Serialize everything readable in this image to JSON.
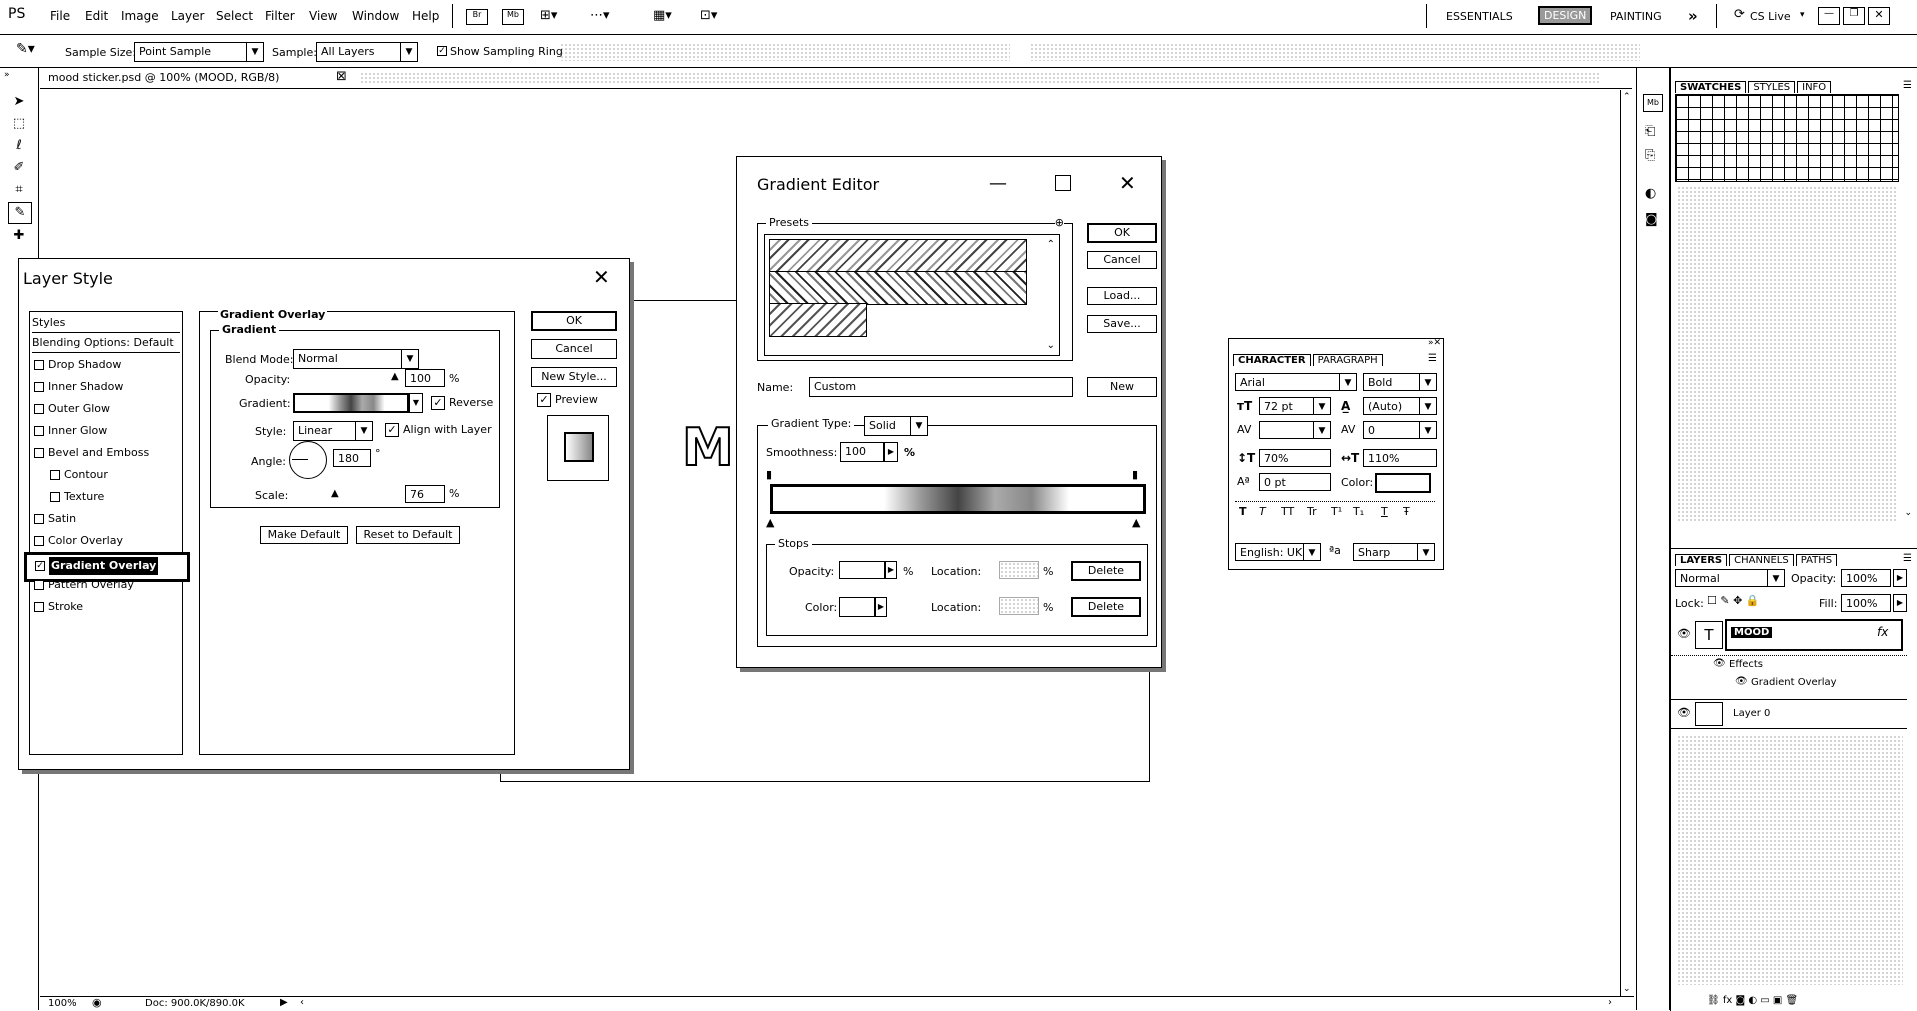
{
  "app": {
    "logo": "PS",
    "menu": [
      "File",
      "Edit",
      "Image",
      "Layer",
      "Select",
      "Filter",
      "View",
      "Window",
      "Help"
    ],
    "workspaces": [
      "ESSENTIALS",
      "DESIGN",
      "PAINTING"
    ],
    "more": "»",
    "cslive": "CS Live"
  },
  "options": {
    "sample_size_label": "Sample Size:",
    "sample_size_value": "Point Sample",
    "sample_label": "Sample:",
    "sample_value": "All Layers",
    "show_ring_label": "Show Sampling Ring"
  },
  "document": {
    "tab_title": "mood sticker.psd @ 100% (MOOD, RGB/8)",
    "tab_close": "⊠",
    "canvas_letter": "M",
    "status_zoom": "100%",
    "status_doc": "Doc: 900.0K/890.0K"
  },
  "layer_style": {
    "title": "Layer Style",
    "styles_header": "Styles",
    "blending": "Blending Options: Default",
    "items": [
      {
        "label": "Drop Shadow",
        "checked": false
      },
      {
        "label": "Inner Shadow",
        "checked": false
      },
      {
        "label": "Outer Glow",
        "checked": false
      },
      {
        "label": "Inner Glow",
        "checked": false
      },
      {
        "label": "Bevel and Emboss",
        "checked": false
      },
      {
        "label": "Contour",
        "checked": false
      },
      {
        "label": "Texture",
        "checked": false
      },
      {
        "label": "Satin",
        "checked": false
      },
      {
        "label": "Color Overlay",
        "checked": false
      },
      {
        "label": "Gradient Overlay",
        "checked": true
      },
      {
        "label": "Pattern Overlay",
        "checked": false
      },
      {
        "label": "Stroke",
        "checked": false
      }
    ],
    "section_title": "Gradient Overlay",
    "sub_title": "Gradient",
    "blend_mode_label": "Blend Mode:",
    "blend_mode_value": "Normal",
    "opacity_label": "Opacity:",
    "opacity_value": "100",
    "percent": "%",
    "gradient_label": "Gradient:",
    "reverse_label": "Reverse",
    "style_label": "Style:",
    "style_value": "Linear",
    "align_label": "Align with Layer",
    "angle_label": "Angle:",
    "angle_value": "180",
    "degree": "°",
    "scale_label": "Scale:",
    "scale_value": "76",
    "make_default": "Make Default",
    "reset_default": "Reset to Default",
    "ok": "OK",
    "cancel": "Cancel",
    "new_style": "New Style...",
    "preview_label": "Preview"
  },
  "gradient_editor": {
    "title": "Gradient Editor",
    "presets_label": "Presets",
    "ok": "OK",
    "cancel": "Cancel",
    "load": "Load...",
    "save": "Save...",
    "name_label": "Name:",
    "name_value": "Custom",
    "new_button": "New",
    "gradient_type_label": "Gradient Type:",
    "gradient_type_value": "Solid",
    "smoothness_label": "Smoothness:",
    "smoothness_value": "100",
    "percent": "%",
    "stops_label": "Stops",
    "opacity_label": "Opacity:",
    "color_label": "Color:",
    "location_label": "Location:",
    "delete": "Delete"
  },
  "character_panel": {
    "tabs": [
      "CHARACTER",
      "PARAGRAPH"
    ],
    "font": "Arial",
    "weight": "Bold",
    "size": "72 pt",
    "leading": "(Auto)",
    "tracking": "0",
    "vscale": "70%",
    "hscale": "110%",
    "baseline": "0 pt",
    "color_label": "Color:",
    "style_buttons": [
      "T",
      "T",
      "TT",
      "Tr",
      "T¹",
      "T₁",
      "T",
      "Ŧ"
    ],
    "language": "English: UK",
    "aa_label": "ªa",
    "aa_value": "Sharp"
  },
  "swatches_panel": {
    "tabs": [
      "SWATCHES",
      "STYLES",
      "INFO"
    ]
  },
  "layers_panel": {
    "tabs": [
      "LAYERS",
      "CHANNELS",
      "PATHS"
    ],
    "blend": "Normal",
    "opacity_label": "Opacity:",
    "opacity_value": "100%",
    "lock_label": "Lock:",
    "fill_label": "Fill:",
    "fill_value": "100%",
    "layers": [
      {
        "name": "MOOD",
        "type": "text",
        "thumb": "T",
        "fx": "fx"
      },
      {
        "name": "Effects",
        "type": "effects"
      },
      {
        "name": "Gradient Overlay",
        "type": "effect"
      },
      {
        "name": "Layer 0",
        "type": "normal"
      }
    ]
  }
}
